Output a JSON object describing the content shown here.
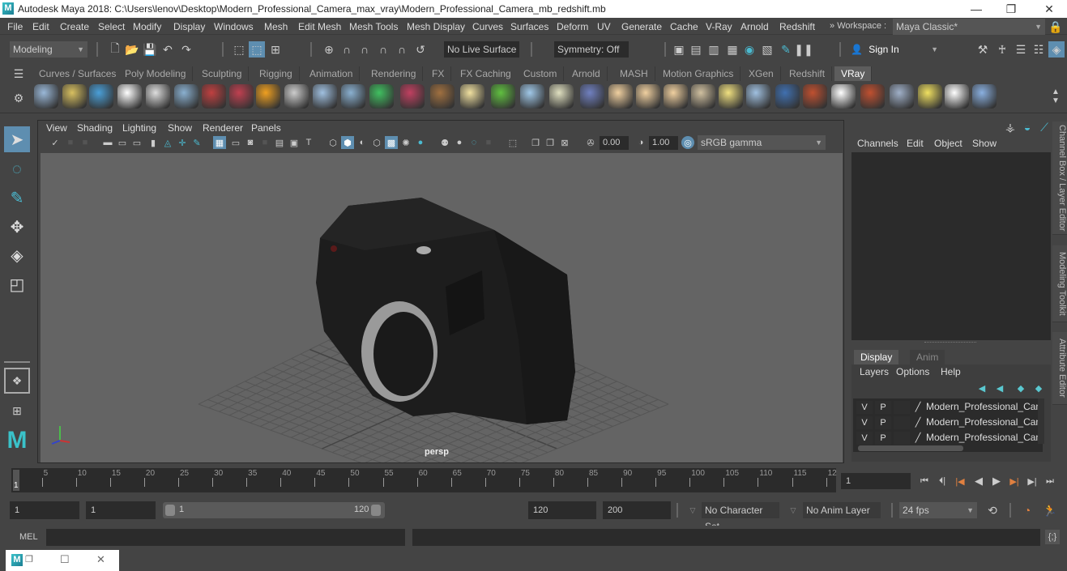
{
  "window": {
    "title": "Autodesk Maya 2018: C:\\Users\\lenov\\Desktop\\Modern_Professional_Camera_max_vray\\Modern_Professional_Camera_mb_redshift.mb",
    "logo": "M",
    "minimize": "—",
    "maximize": "❐",
    "close": "✕"
  },
  "menubar": {
    "items": [
      "File",
      "Edit",
      "Create",
      "Select",
      "Modify",
      "Display",
      "Windows",
      "Mesh",
      "Edit Mesh",
      "Mesh Tools",
      "Mesh Display",
      "Curves",
      "Surfaces",
      "Deform",
      "UV",
      "Generate",
      "Cache",
      "V-Ray",
      "Arnold",
      "Redshift"
    ],
    "workspace_label": "Workspace :",
    "workspace_value": "Maya Classic*"
  },
  "statusline": {
    "mode": "Modeling",
    "live_surface": "No Live Surface",
    "symmetry": "Symmetry: Off",
    "sign_in": "Sign In"
  },
  "shelf": {
    "tabs": [
      "Curves / Surfaces",
      "Poly Modeling",
      "Sculpting",
      "Rigging",
      "Animation",
      "Rendering",
      "FX",
      "FX Caching",
      "Custom",
      "Arnold",
      "MASH",
      "Motion Graphics",
      "XGen",
      "Redshift",
      "VRay"
    ],
    "active_tab": "VRay",
    "icons": [
      {
        "name": "vray-export-scene-icon",
        "color": "#9ab8d8"
      },
      {
        "name": "vray-export-folder-icon",
        "color": "#d8c060"
      },
      {
        "name": "vray-frame-buffer-list-icon",
        "color": "#4a9fd8"
      },
      {
        "name": "vray-logo-icon",
        "color": "#ffffff"
      },
      {
        "name": "vray-document-icon",
        "color": "#dddddd"
      },
      {
        "name": "vray-material-ball-icon",
        "color": "#8ab0d0"
      },
      {
        "name": "vray-proxy-icon",
        "color": "#c04040"
      },
      {
        "name": "vray-multi-material-icon",
        "color": "#c04050"
      },
      {
        "name": "vray-fire-icon",
        "color": "#f0a020"
      },
      {
        "name": "vray-plane-icon",
        "color": "#cccccc"
      },
      {
        "name": "vray-rect-light-icon",
        "color": "#a0c0e0"
      },
      {
        "name": "vray-cone-icon",
        "color": "#8ab0d0"
      },
      {
        "name": "vray-env-fog-icon",
        "color": "#40c060"
      },
      {
        "name": "vray-fur-icon",
        "color": "#c04060"
      },
      {
        "name": "vray-texture-icon",
        "color": "#a07040"
      },
      {
        "name": "vray-sphere-light-icon",
        "color": "#f0e0a0"
      },
      {
        "name": "vray-grass-icon",
        "color": "#60c040"
      },
      {
        "name": "vray-particles-icon",
        "color": "#a0c8e8"
      },
      {
        "name": "vray-curve-icon",
        "color": "#e0e0c0"
      },
      {
        "name": "vray-globe-icon",
        "color": "#7080c0"
      },
      {
        "name": "vray-dome-light-icon",
        "color": "#f0d0a0"
      },
      {
        "name": "vray-spot-light-icon",
        "color": "#f0d0a0"
      },
      {
        "name": "vray-omni-light-icon",
        "color": "#f0d0a0"
      },
      {
        "name": "vray-ies-light-icon",
        "color": "#d0c0a0"
      },
      {
        "name": "vray-sun-icon",
        "color": "#f0e080"
      },
      {
        "name": "vray-sky-icon",
        "color": "#a0c0e0"
      },
      {
        "name": "vray-blue-sphere-icon",
        "color": "#4070b0"
      },
      {
        "name": "vray-flag-sphere-icon",
        "color": "#c05030"
      },
      {
        "name": "vray-checker-icon",
        "color": "#ffffff"
      },
      {
        "name": "vray-render-window-icon",
        "color": "#c05030"
      },
      {
        "name": "vray-settings-icon",
        "color": "#a0b0c8"
      },
      {
        "name": "vray-light-lister-icon",
        "color": "#f0e060"
      },
      {
        "name": "vray-cloud-icon",
        "color": "#ffffff"
      },
      {
        "name": "vray-help-icon",
        "color": "#8ab0e0"
      }
    ]
  },
  "viewport": {
    "menus": [
      "View",
      "Shading",
      "Lighting",
      "Show",
      "Renderer",
      "Panels"
    ],
    "exposure": "0.00",
    "gamma": "1.00",
    "color_space": "sRGB gamma",
    "camera_label": "persp",
    "axis": {
      "x": "x",
      "y": "y",
      "z": "z"
    }
  },
  "channelbox": {
    "menus": [
      "Channels",
      "Edit",
      "Object",
      "Show"
    ]
  },
  "layereditor": {
    "tabs": [
      "Display",
      "Anim"
    ],
    "active_tab": "Display",
    "menus": [
      "Layers",
      "Options",
      "Help"
    ],
    "layers": [
      {
        "v": "V",
        "p": "P",
        "name": "Modern_Professional_Came"
      },
      {
        "v": "V",
        "p": "P",
        "name": "Modern_Professional_Came"
      },
      {
        "v": "V",
        "p": "P",
        "name": "Modern_Professional_Came"
      }
    ]
  },
  "sidetabs": [
    "Channel Box / Layer Editor",
    "Modeling Toolkit",
    "Attribute Editor"
  ],
  "timeslider": {
    "ticks": [
      "5",
      "10",
      "15",
      "20",
      "25",
      "30",
      "35",
      "40",
      "45",
      "50",
      "55",
      "60",
      "65",
      "70",
      "75",
      "80",
      "85",
      "90",
      "95",
      "100",
      "105",
      "110",
      "115",
      "12"
    ],
    "current_frame_marker": "1",
    "current_frame": "1"
  },
  "rangeslider": {
    "start": "1",
    "playback_start": "1",
    "range_start_label": "1",
    "range_end_label": "120",
    "playback_end": "120",
    "end": "200",
    "character_set": "No Character Set",
    "anim_layer": "No Anim Layer",
    "fps": "24 fps"
  },
  "commandline": {
    "label": "MEL"
  },
  "colors": {
    "accent": "#5e8eb0",
    "background": "#444444",
    "field": "#2b2b2b",
    "viewport": "#646464"
  }
}
